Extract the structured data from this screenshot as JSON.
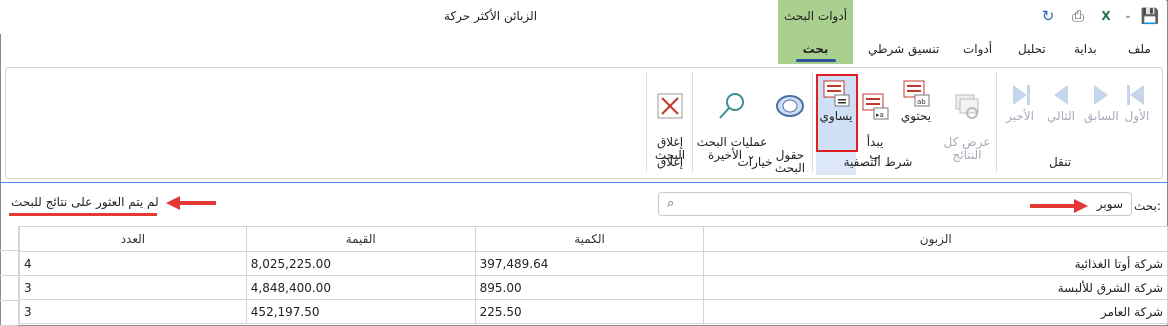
{
  "window": {
    "title": "الزبائن الأكثر حركة"
  },
  "context_tab": {
    "group": "أدوات البحث",
    "tab": "بحث"
  },
  "tabs": [
    "ملف",
    "بداية",
    "تحليل",
    "أدوات",
    "تنسيق شرطي"
  ],
  "ribbon": {
    "nav": {
      "first": "الأول",
      "prev": "السابق",
      "next": "التالي",
      "last": "الأخير",
      "show_all": "عرض كل\nالنتائج",
      "group": "تنقل"
    },
    "filter": {
      "contains": "يحتوي",
      "starts_with": "يبدأ\nب",
      "equals": "يساوي",
      "group": "شرط التصفية"
    },
    "options": {
      "search_fields": "حقول\nالبحث",
      "recent": "عمليات البحث\nالأخيرة ⌄",
      "group": "خيارات"
    },
    "close": {
      "close_search": "إغلاق\nالبحث",
      "group": "إغلاق"
    }
  },
  "search": {
    "label": "بحث:",
    "value": "سوبر",
    "status": "لم يتم العثور على نتائج للبحث"
  },
  "grid": {
    "columns": [
      "الزبون",
      "الكمية",
      "القيمة",
      "العدد"
    ],
    "rows": [
      [
        "شركة أوتا الغذائية",
        "397,489.64",
        "8,025,225.00",
        "4"
      ],
      [
        "شركة الشرق للألبسة",
        "895.00",
        "4,848,400.00",
        "3"
      ],
      [
        "شركة العامر",
        "225.50",
        "452,197.50",
        "3"
      ]
    ]
  },
  "colors": {
    "accent": "#2b579a",
    "context_tab": "#a9d08e",
    "alert": "#e53935"
  }
}
